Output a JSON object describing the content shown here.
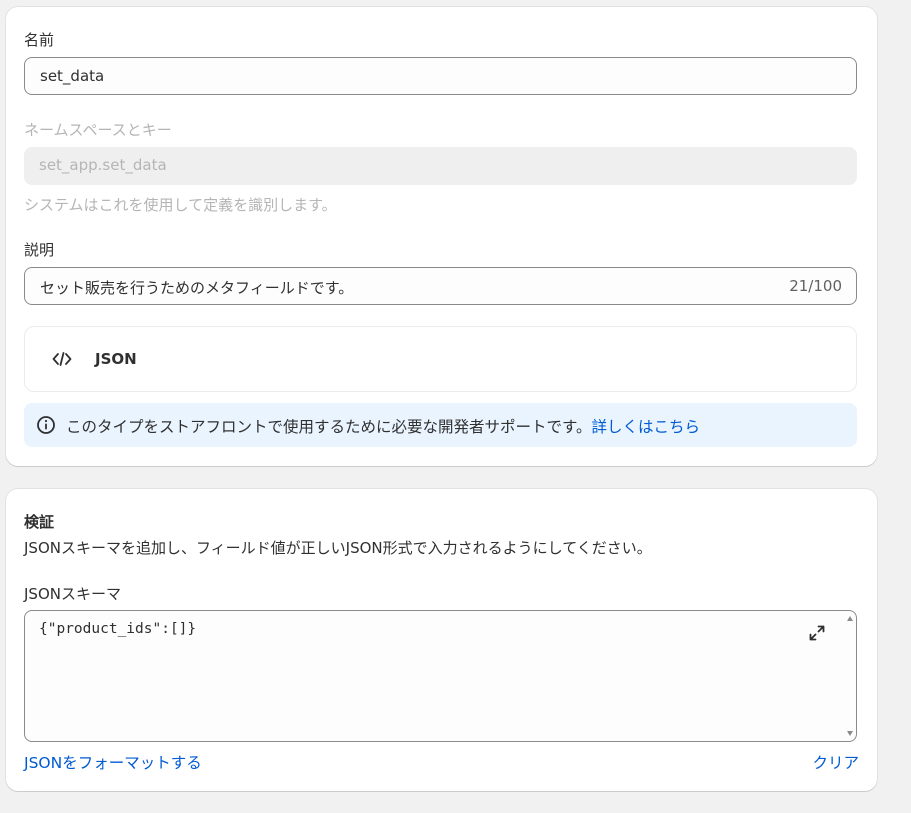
{
  "name_field": {
    "label": "名前",
    "value": "set_data"
  },
  "namespace_field": {
    "label": "ネームスペースとキー",
    "value": "set_app.set_data",
    "help": "システムはこれを使用して定義を識別します。"
  },
  "description_field": {
    "label": "説明",
    "value": "セット販売を行うためのメタフィールドです。",
    "counter": "21/100"
  },
  "type": {
    "icon": "code-icon",
    "name": "JSON"
  },
  "info_banner": {
    "icon": "info-icon",
    "text": "このタイプをストアフロントで使用するために必要な開発者サポートです。",
    "link": "詳しくはこちら",
    "accent": "#eaf4ff"
  },
  "validation": {
    "title": "検証",
    "description": "JSONスキーマを追加し、フィールド値が正しいJSON形式で入力されるようにしてください。",
    "schema_label": "JSONスキーマ",
    "schema_value": "{\"product_ids\":[]}",
    "expand_icon": "expand-icon",
    "format_link": "JSONをフォーマットする",
    "clear_link": "クリア"
  },
  "colors": {
    "link": "#005bd3",
    "background": "#f1f1f1"
  }
}
